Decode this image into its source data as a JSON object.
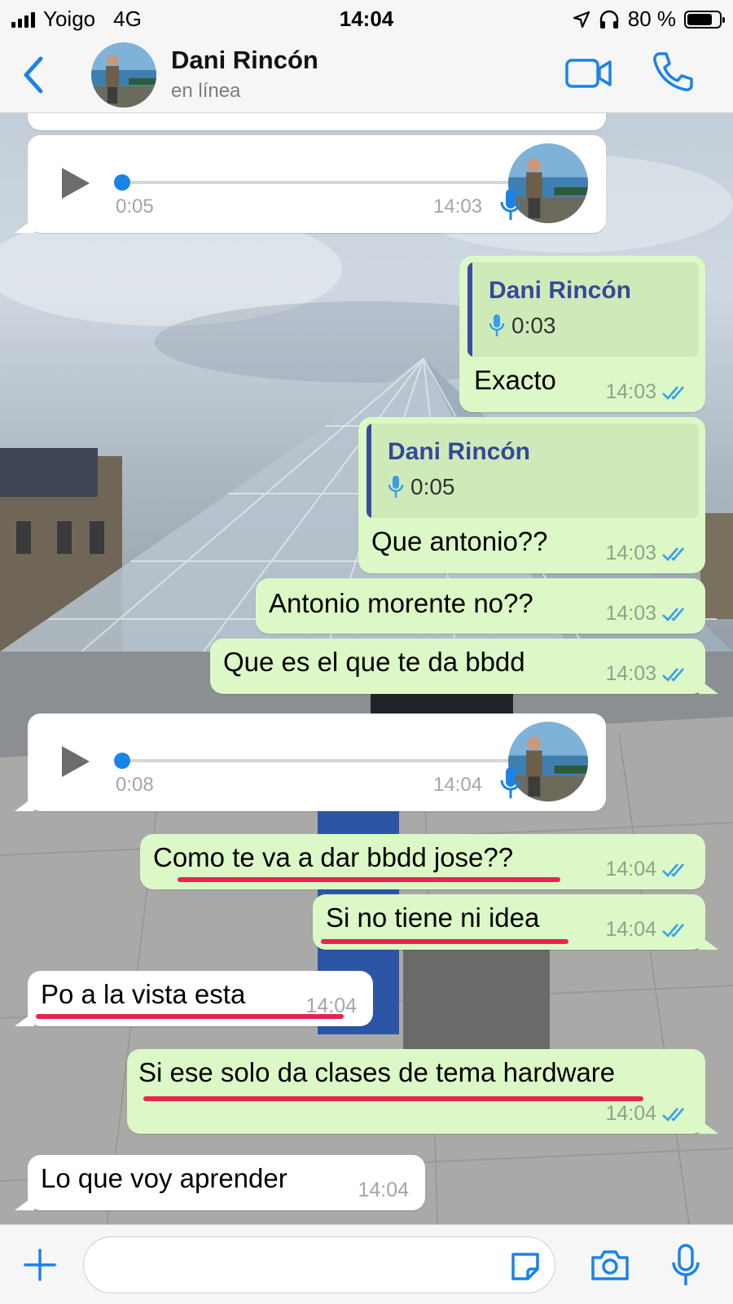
{
  "status_bar": {
    "carrier": "Yoigo",
    "network": "4G",
    "time": "14:04",
    "battery": "80 %",
    "battery_level": 0.8
  },
  "header": {
    "contact_name": "Dani Rincón",
    "contact_status": "en línea",
    "icons": [
      "chevron-left-icon",
      "avatar",
      "video-call-icon",
      "phone-icon"
    ]
  },
  "messages": [
    {
      "type": "voice",
      "direction": "in",
      "duration": "0:05",
      "time": "14:03"
    },
    {
      "type": "reply",
      "direction": "out",
      "quoted_name": "Dani Rincón",
      "quoted_duration": "0:03",
      "text": "Exacto",
      "time": "14:03"
    },
    {
      "type": "reply",
      "direction": "out",
      "quoted_name": "Dani Rincón",
      "quoted_duration": "0:05",
      "text": "Que antonio??",
      "time": "14:03"
    },
    {
      "type": "text",
      "direction": "out",
      "text": "Antonio morente no??",
      "time": "14:03"
    },
    {
      "type": "text",
      "direction": "out",
      "text": "Que es el que te da bbdd",
      "time": "14:03"
    },
    {
      "type": "voice",
      "direction": "in",
      "duration": "0:08",
      "time": "14:04"
    },
    {
      "type": "text",
      "direction": "out",
      "text": "Como te va a dar bbdd jose??",
      "time": "14:04"
    },
    {
      "type": "text",
      "direction": "out",
      "text": "Si no tiene ni idea",
      "time": "14:04"
    },
    {
      "type": "text",
      "direction": "in",
      "text": "Po a la vista esta",
      "time": "14:04"
    },
    {
      "type": "text",
      "direction": "out",
      "text": "Si ese solo da clases de tema hardware",
      "time": "14:04"
    },
    {
      "type": "text",
      "direction": "in",
      "text": "Lo que voy aprender",
      "time": "14:04"
    }
  ],
  "input_bar": {
    "placeholder": "",
    "icons": [
      "plus-icon",
      "sticker-icon",
      "camera-icon",
      "microphone-icon"
    ]
  },
  "colors": {
    "accent": "#1a83e8",
    "outgoing_bubble": "#dcf8c6",
    "incoming_bubble": "#ffffff",
    "quote_name": "#35499a",
    "read_ticks": "#3a9ee8",
    "annotation_underline": "#e8244f"
  }
}
